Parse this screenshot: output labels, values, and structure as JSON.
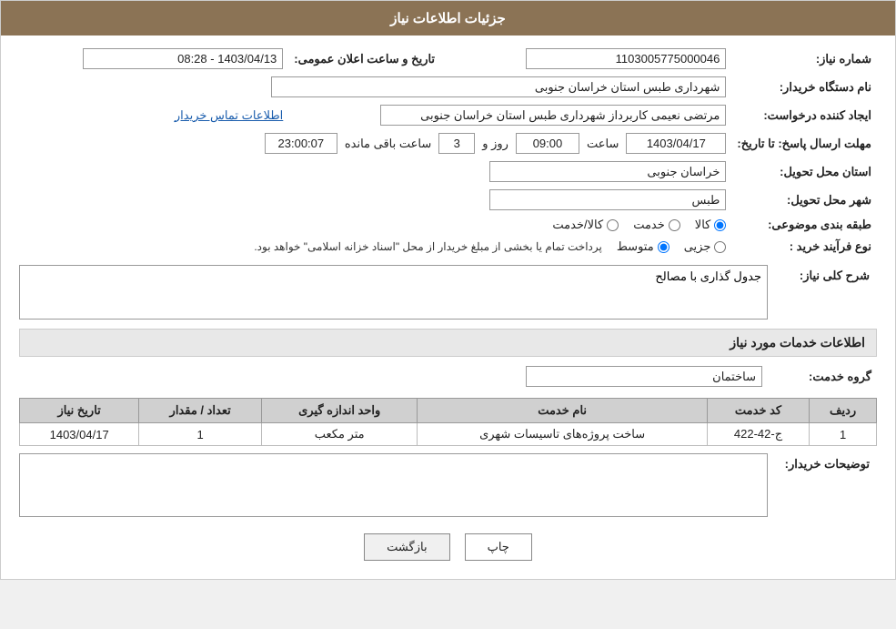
{
  "header": {
    "title": "جزئیات اطلاعات نیاز"
  },
  "fields": {
    "need_number_label": "شماره نیاز:",
    "need_number_value": "1103005775000046",
    "buyer_org_label": "نام دستگاه خریدار:",
    "buyer_org_value": "شهرداری طبس استان خراسان جنوبی",
    "announce_datetime_label": "تاریخ و ساعت اعلان عمومی:",
    "announce_datetime_value": "1403/04/13 - 08:28",
    "creator_label": "ایجاد کننده درخواست:",
    "creator_value": "مرتضی نعیمی کاربرداز شهرداری طبس استان خراسان جنوبی",
    "contact_link": "اطلاعات تماس خریدار",
    "response_deadline_label": "مهلت ارسال پاسخ: تا تاریخ:",
    "response_date": "1403/04/17",
    "response_time_label": "ساعت",
    "response_time": "09:00",
    "response_days_label": "روز و",
    "response_days": "3",
    "response_remaining_label": "ساعت باقی مانده",
    "response_remaining": "23:00:07",
    "province_label": "استان محل تحویل:",
    "province_value": "خراسان جنوبی",
    "city_label": "شهر محل تحویل:",
    "city_value": "طبس",
    "category_label": "طبقه بندی موضوعی:",
    "category_options": [
      "کالا",
      "خدمت",
      "کالا/خدمت"
    ],
    "category_selected": "کالا",
    "process_type_label": "نوع فرآیند خرید :",
    "process_options": [
      "جزیی",
      "متوسط"
    ],
    "process_note": "پرداخت تمام یا بخشی از مبلغ خریدار از محل \"اسناد خزانه اسلامی\" خواهد بود.",
    "need_description_label": "شرح کلی نیاز:",
    "need_description_value": "جدول گذاری با مصالح",
    "service_info_label": "اطلاعات خدمات مورد نیاز",
    "service_group_label": "گروه خدمت:",
    "service_group_value": "ساختمان",
    "table": {
      "headers": [
        "ردیف",
        "کد خدمت",
        "نام خدمت",
        "واحد اندازه گیری",
        "تعداد / مقدار",
        "تاریخ نیاز"
      ],
      "rows": [
        {
          "row": "1",
          "code": "ج-42-422",
          "name": "ساخت پروژه‌های تاسیسات شهری",
          "unit": "متر مکعب",
          "quantity": "1",
          "date": "1403/04/17"
        }
      ]
    },
    "buyer_desc_label": "توضیحات خریدار:",
    "buyer_desc_value": ""
  },
  "buttons": {
    "print": "چاپ",
    "back": "بازگشت"
  }
}
